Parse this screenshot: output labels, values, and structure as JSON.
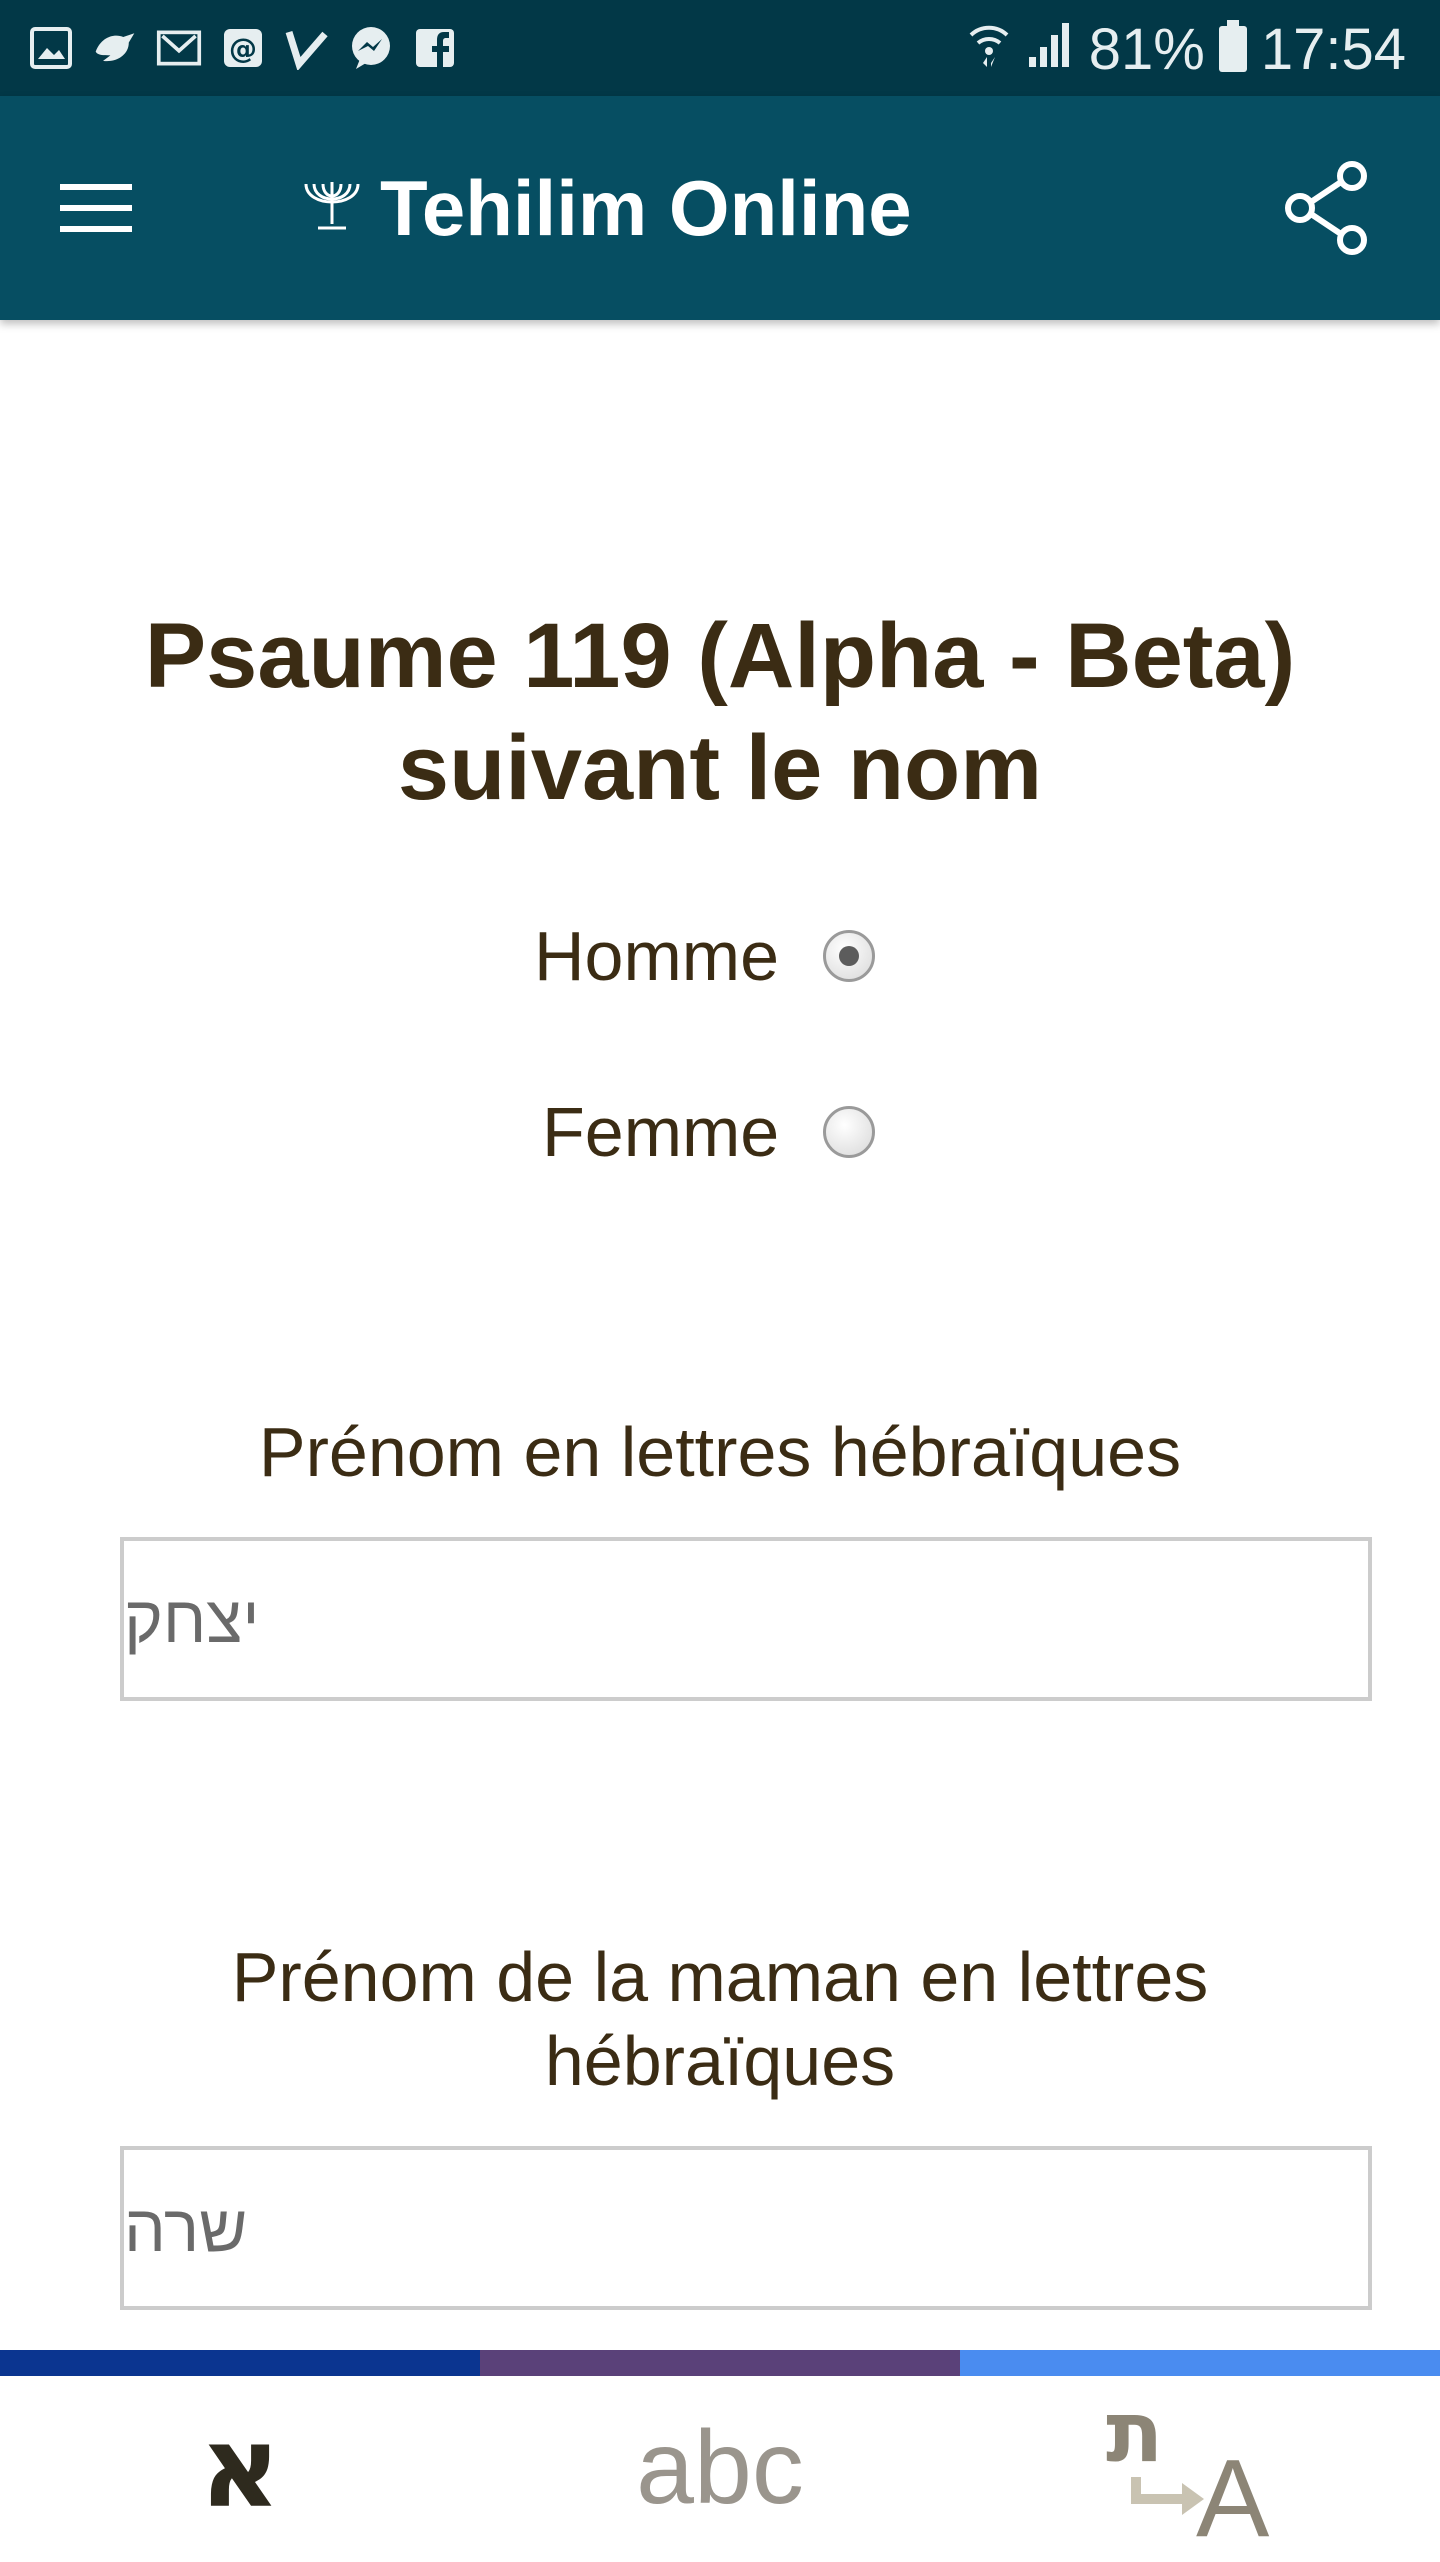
{
  "status_bar": {
    "notification_icons": [
      "gallery-icon",
      "bird-app-icon",
      "gmail-icon",
      "email-icon",
      "tasks-check-icon",
      "messenger-icon",
      "facebook-icon"
    ],
    "battery_percent": "81%",
    "time": "17:54"
  },
  "app_bar": {
    "title": "Tehilim Online"
  },
  "main": {
    "title": "Psaume 119 (Alpha - Beta) suivant le nom",
    "gender": {
      "options": [
        {
          "label": "Homme",
          "selected": true
        },
        {
          "label": "Femme",
          "selected": false
        }
      ]
    },
    "first_name": {
      "label": "Prénom en lettres hébraïques",
      "placeholder": "יצחק"
    },
    "mother_name": {
      "label": "Prénom de la maman en lettres hébraïques",
      "placeholder": "שרה"
    }
  },
  "bottom_nav": {
    "tabs": [
      {
        "label": "א",
        "active": true
      },
      {
        "label": "abc",
        "active": false
      },
      {
        "label_hebrew": "ת",
        "label_latin": "A",
        "active": false
      }
    ]
  },
  "colors": {
    "status_bar": "#023847",
    "app_bar": "#064e62",
    "title_text": "#3b2c14",
    "stripe": [
      "#0b3590",
      "#5a4179",
      "#4a8cf0"
    ]
  }
}
